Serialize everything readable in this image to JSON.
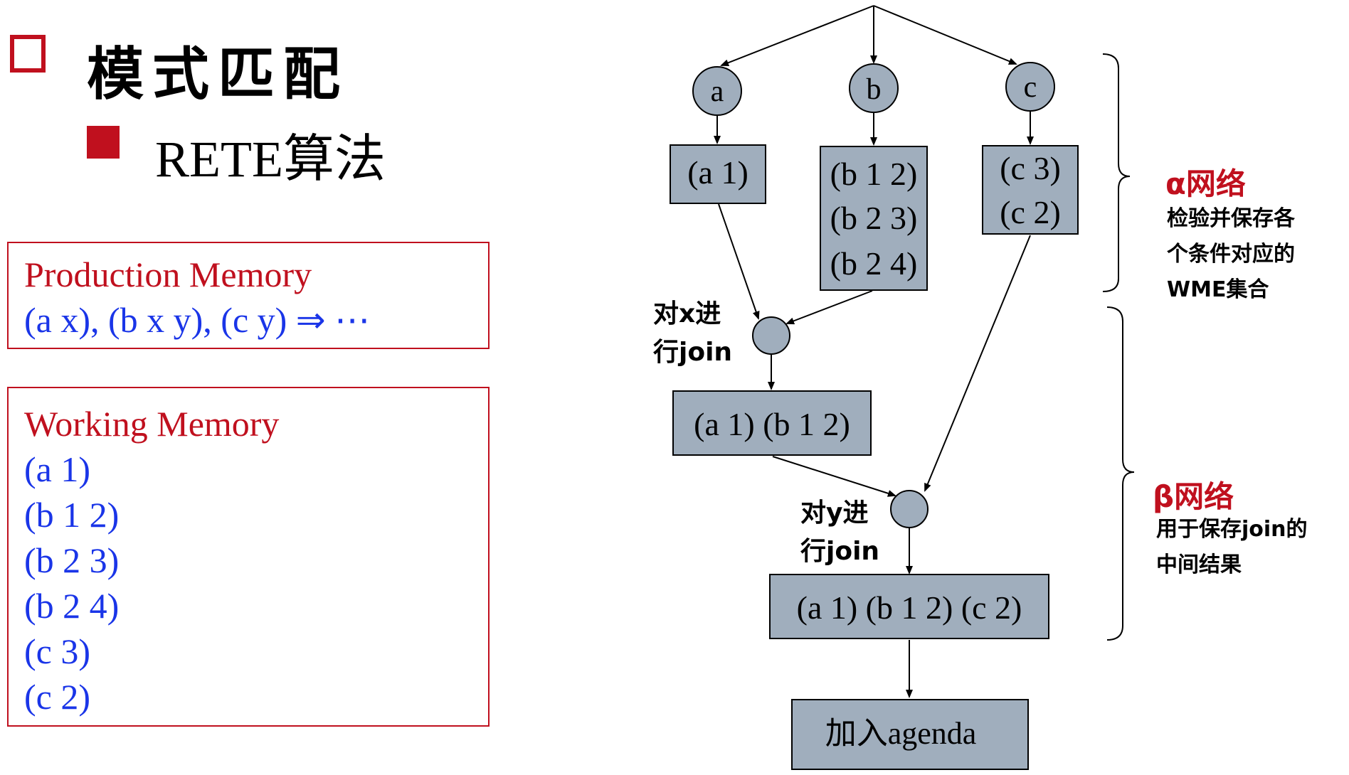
{
  "title": "模式匹配",
  "subtitle": "RETE算法",
  "production_memory": {
    "label": "Production Memory",
    "rule": "(a x), (b x y), (c y) ⇒ ⋯"
  },
  "working_memory": {
    "label": "Working Memory",
    "items": [
      "(a 1)",
      "(b 1 2)",
      "(b 2 3)",
      "(b 2 4)",
      "(c 3)",
      "(c 2)"
    ]
  },
  "diagram": {
    "nodes": {
      "a": "a",
      "b": "b",
      "c": "c"
    },
    "alpha_a": [
      "(a 1)"
    ],
    "alpha_b": [
      "(b 1 2)",
      "(b 2 3)",
      "(b 2 4)"
    ],
    "alpha_c": [
      "(c 3)",
      "(c 2)"
    ],
    "join_x_label": [
      "对x进",
      "行join"
    ],
    "join_y_label": [
      "对y进",
      "行join"
    ],
    "beta_1": "(a 1) (b 1 2)",
    "beta_2": "(a 1) (b 1 2) (c 2)",
    "agenda": "加入agenda"
  },
  "alpha_network": {
    "title": "α网络",
    "description": [
      "检验并保存各",
      "个条件对应的",
      "WME集合"
    ]
  },
  "beta_network": {
    "title": "β网络",
    "description": [
      "用于保存join的",
      "中间结果"
    ]
  },
  "colors": {
    "accent_red": "#c0101e",
    "text_blue": "#1a35e8",
    "node_fill": "#a0aebd"
  }
}
